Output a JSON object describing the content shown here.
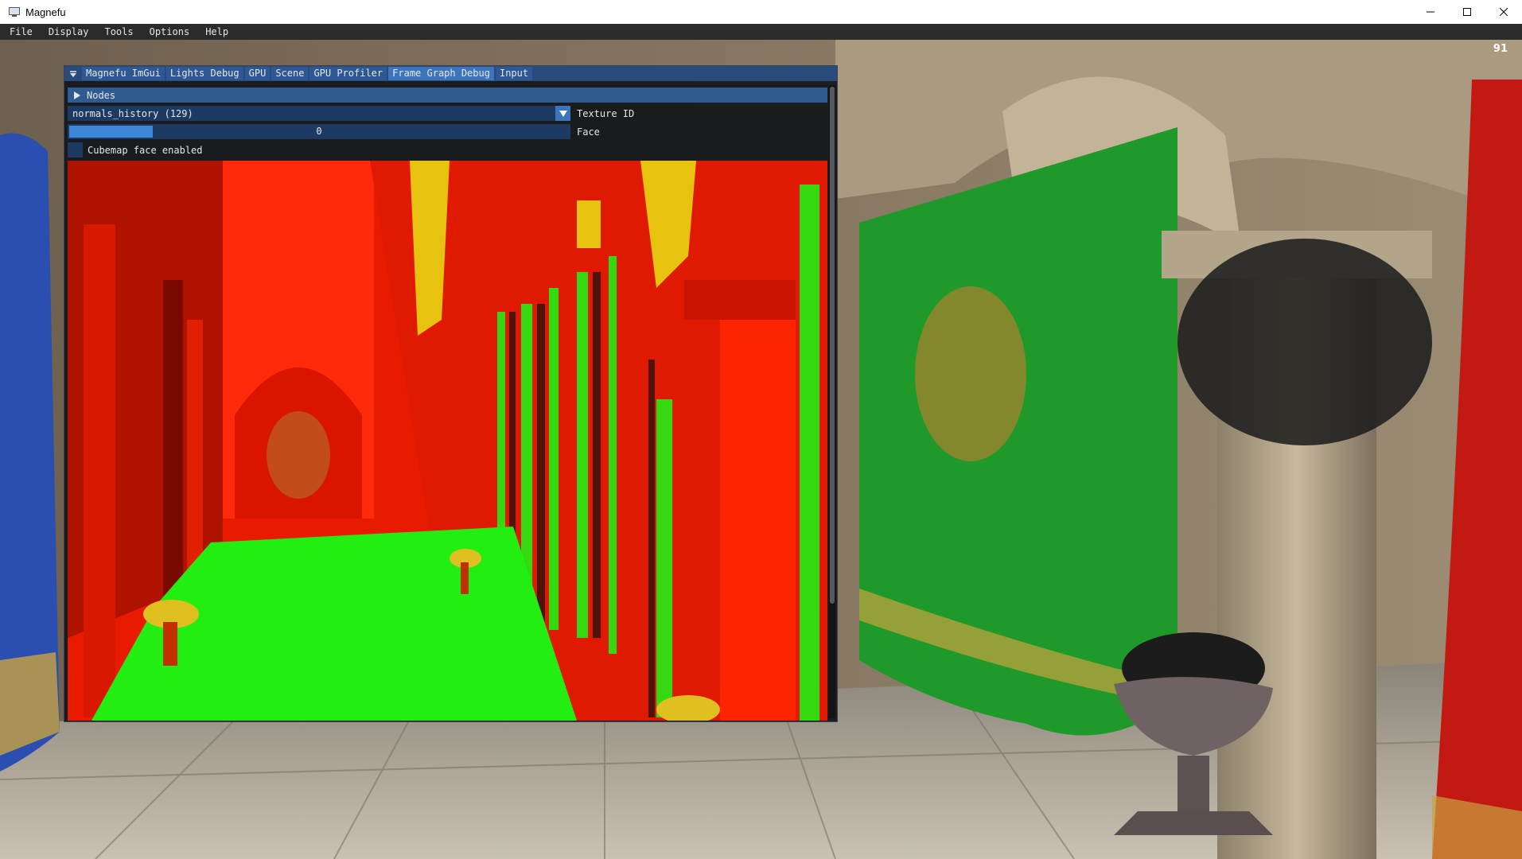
{
  "window": {
    "title": "Magnefu",
    "icon": "monitor-icon",
    "controls": [
      "minimize-icon",
      "maximize-icon",
      "close-icon"
    ]
  },
  "menu": [
    "File",
    "Display",
    "Tools",
    "Options",
    "Help"
  ],
  "fps": "91",
  "imgui": {
    "tabs": [
      {
        "label": "Magnefu ImGui",
        "active": false
      },
      {
        "label": "Lights Debug",
        "active": false
      },
      {
        "label": "GPU",
        "active": false
      },
      {
        "label": "Scene",
        "active": false
      },
      {
        "label": "GPU Profiler",
        "active": false
      },
      {
        "label": "Frame Graph Debug",
        "active": true
      },
      {
        "label": "Input",
        "active": false
      }
    ],
    "nodes_header": "Nodes",
    "texture_combo": {
      "value": "normals_history (129)",
      "label": "Texture ID"
    },
    "face_slider": {
      "value": "0",
      "label": "Face",
      "fill_fraction": 0.167
    },
    "cubemap_checkbox": {
      "label": "Cubemap face enabled",
      "checked": false
    }
  },
  "colors": {
    "title_bar": "#294a7a",
    "tab_active": "#3d75bd",
    "frame_bg": "#1d3a63",
    "normals_red": "#ff1a00",
    "normals_green": "#22ee11"
  }
}
